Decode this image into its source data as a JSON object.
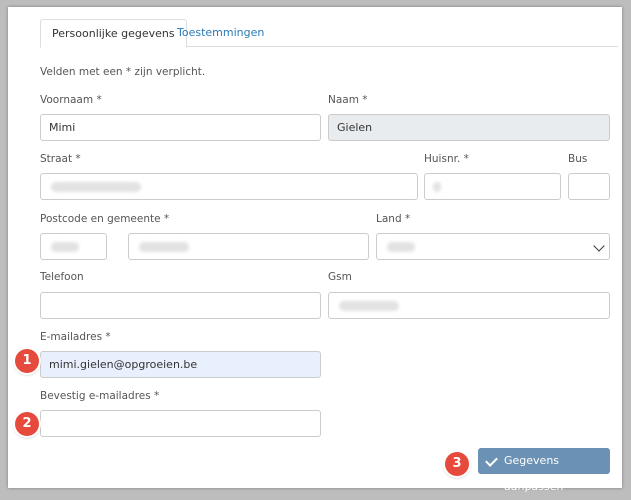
{
  "tabs": [
    {
      "label": "Persoonlijke gegevens",
      "active": true
    },
    {
      "label": "Toestemmingen",
      "active": false
    }
  ],
  "required_note": "Velden met een * zijn verplicht.",
  "fields": {
    "voornaam": {
      "label": "Voornaam *",
      "value": "Mimi"
    },
    "naam": {
      "label": "Naam *",
      "value": "Gielen"
    },
    "straat": {
      "label": "Straat *",
      "value": ""
    },
    "huisnr": {
      "label": "Huisnr. *",
      "value": ""
    },
    "bus": {
      "label": "Bus",
      "value": ""
    },
    "postcode": {
      "label": "Postcode en gemeente *",
      "value": ""
    },
    "land": {
      "label": "Land *",
      "value": ""
    },
    "telefoon": {
      "label": "Telefoon",
      "value": ""
    },
    "gsm": {
      "label": "Gsm",
      "value": ""
    },
    "email": {
      "label": "E-mailadres *",
      "value": "mimi.gielen@opgroeien.be"
    },
    "email_confirm": {
      "label": "Bevestig e-mailadres *",
      "value": ""
    }
  },
  "submit_label": "Gegevens aanpassen",
  "badges": [
    "1",
    "2",
    "3"
  ],
  "colors": {
    "badge": "#e64a3c",
    "button": "#6b91b4",
    "link": "#2a7ab8"
  }
}
